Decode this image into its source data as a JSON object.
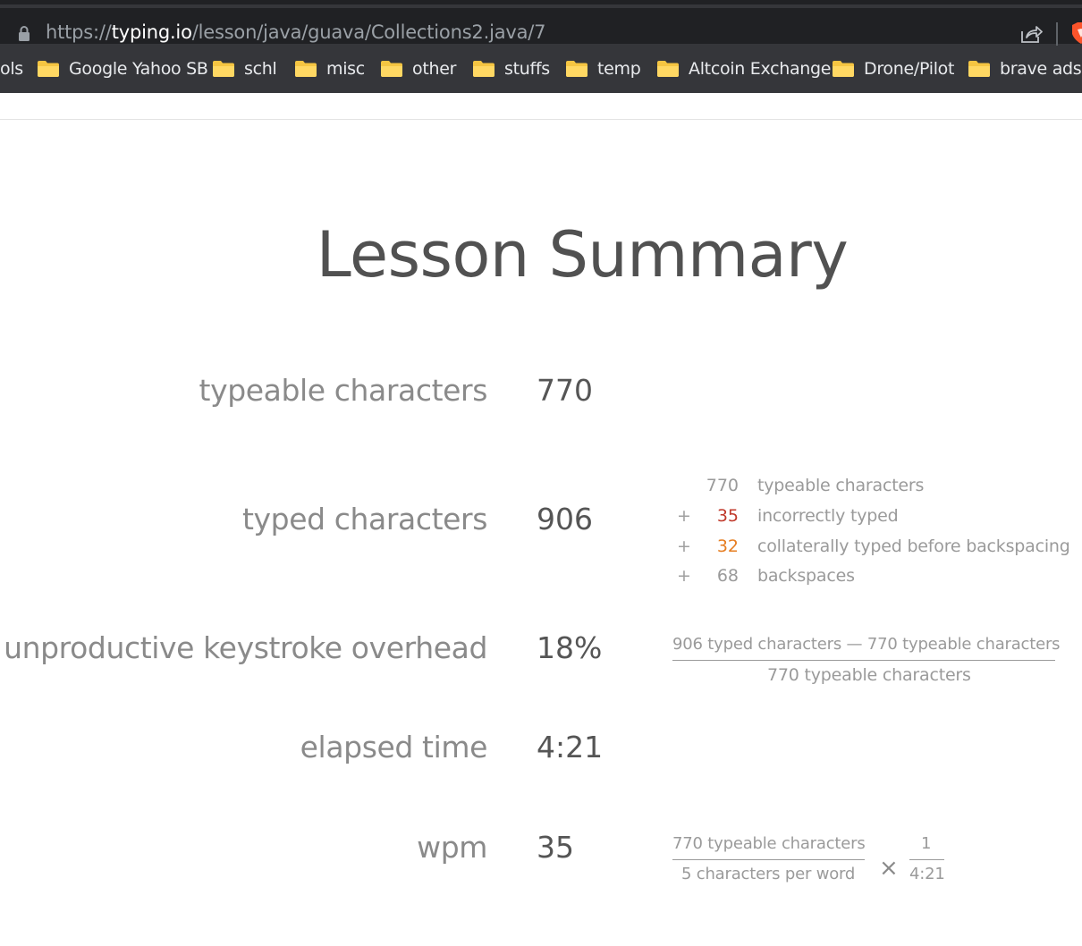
{
  "browser": {
    "url_prefix": "https://",
    "url_host": "typing.io",
    "url_path": "/lesson/java/guava/Collections2.java/7",
    "bookmarks": [
      "ols",
      "Google Yahoo SB",
      "schl",
      "misc",
      "other",
      "stuffs",
      "temp",
      "Altcoin Exchange",
      "Drone/Pilot",
      "brave ads"
    ]
  },
  "page": {
    "title": "Lesson Summary"
  },
  "stats": {
    "typeable": {
      "label": "typeable characters",
      "value": "770"
    },
    "typed": {
      "label": "typed characters",
      "value": "906"
    },
    "overhead": {
      "label": "unproductive keystroke overhead",
      "value": "18%"
    },
    "elapsed": {
      "label": "elapsed time",
      "value": "4:21"
    },
    "wpm": {
      "label": "wpm",
      "value": "35"
    }
  },
  "typed_breakdown": [
    {
      "op": "",
      "count": "770",
      "text": "typeable characters",
      "color": "#9a9a9a"
    },
    {
      "op": "+",
      "count": "35",
      "text": "incorrectly typed",
      "color": "#c0392b"
    },
    {
      "op": "+",
      "count": "32",
      "text": "collaterally typed before backspacing",
      "color": "#e67e22"
    },
    {
      "op": "+",
      "count": "68",
      "text": "backspaces",
      "color": "#9a9a9a"
    }
  ],
  "overhead_formula": {
    "numerator": "906 typed characters — 770 typeable characters",
    "denominator": "770 typeable characters"
  },
  "wpm_formula": {
    "numerator": "770 typeable characters",
    "denominator": "5 characters per word",
    "operator": "×",
    "second_numerator": "1",
    "second_denominator": "4:21"
  }
}
